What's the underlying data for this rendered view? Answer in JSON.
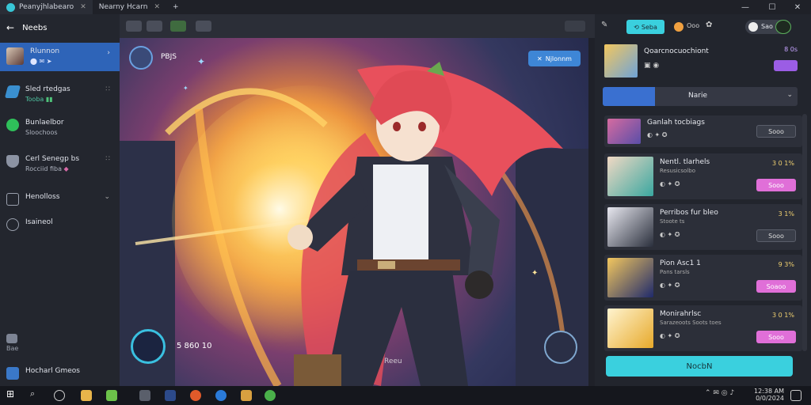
{
  "titlebar": {
    "tabs": [
      {
        "label": "Peanyjhlabearo"
      },
      {
        "label": "Nearny Hcarn"
      }
    ],
    "new_tab": "+",
    "controls": {
      "minimize": "—",
      "maximize": "☐",
      "close": "✕"
    }
  },
  "sidebar": {
    "back_label": "Neebs",
    "items": [
      {
        "label": "Rlunnon",
        "icon": "avatar"
      },
      {
        "label": "Sled rtedgas",
        "sub1": "Tooba",
        "icon": "diamond-icon"
      },
      {
        "label": "Bunlaelbor",
        "sub1": "Sloochoos",
        "icon": "whatsapp-icon"
      },
      {
        "label": "Cerl Senegp bs",
        "sub1": "Rocciid fiba",
        "icon": "shield-icon"
      },
      {
        "label": "Henolloss",
        "icon": "document-icon"
      },
      {
        "label": "Isaineol",
        "icon": "globe-icon"
      }
    ],
    "bottom_item": "Hocharl Gmeos",
    "bottom_small": "Bae"
  },
  "center": {
    "corner_label": "PBJS",
    "action_button": "Njlonnm",
    "counter_text": "5 860 10",
    "watermark": "Reeu"
  },
  "rightpanel": {
    "header_icons": [
      "Seba",
      "Ooo",
      "Sao"
    ],
    "top_card": {
      "title": "Qoarcnocuochiont",
      "badge": "8 0s"
    },
    "dropdown_label": "Narie",
    "list": [
      {
        "title": "Ganlah tocbiags",
        "pill": "Sooo",
        "style": "dark"
      },
      {
        "title": "Nentl. tlarhels",
        "sub": "Resusicsolbo",
        "rating": "3 0 1%",
        "pill": "Sooo",
        "style": "pink"
      },
      {
        "title": "Perribos fur bleo",
        "sub": "Stoote ts",
        "rating": "3 1%",
        "pill": "Sooo",
        "style": "dark"
      },
      {
        "title": "Pion Asc1 1",
        "sub": "Pans tarsls",
        "rating": "9 3%",
        "pill": "Soaoo",
        "style": "pink"
      },
      {
        "title": "Monirahrlsc",
        "sub": "Sarazeoots Soots toes",
        "rating": "3 0 1%",
        "pill": "Sooo",
        "style": "pink"
      }
    ],
    "footer_button": "NocbN"
  },
  "taskbar": {
    "tray_time": "12:38 AM",
    "tray_date": "0/0/2024"
  },
  "colors": {
    "accent": "#3ad0de",
    "pink": "#e06fd8",
    "sidebar_active": "#2e64b8",
    "dropdown_blue": "#3a70d0"
  }
}
